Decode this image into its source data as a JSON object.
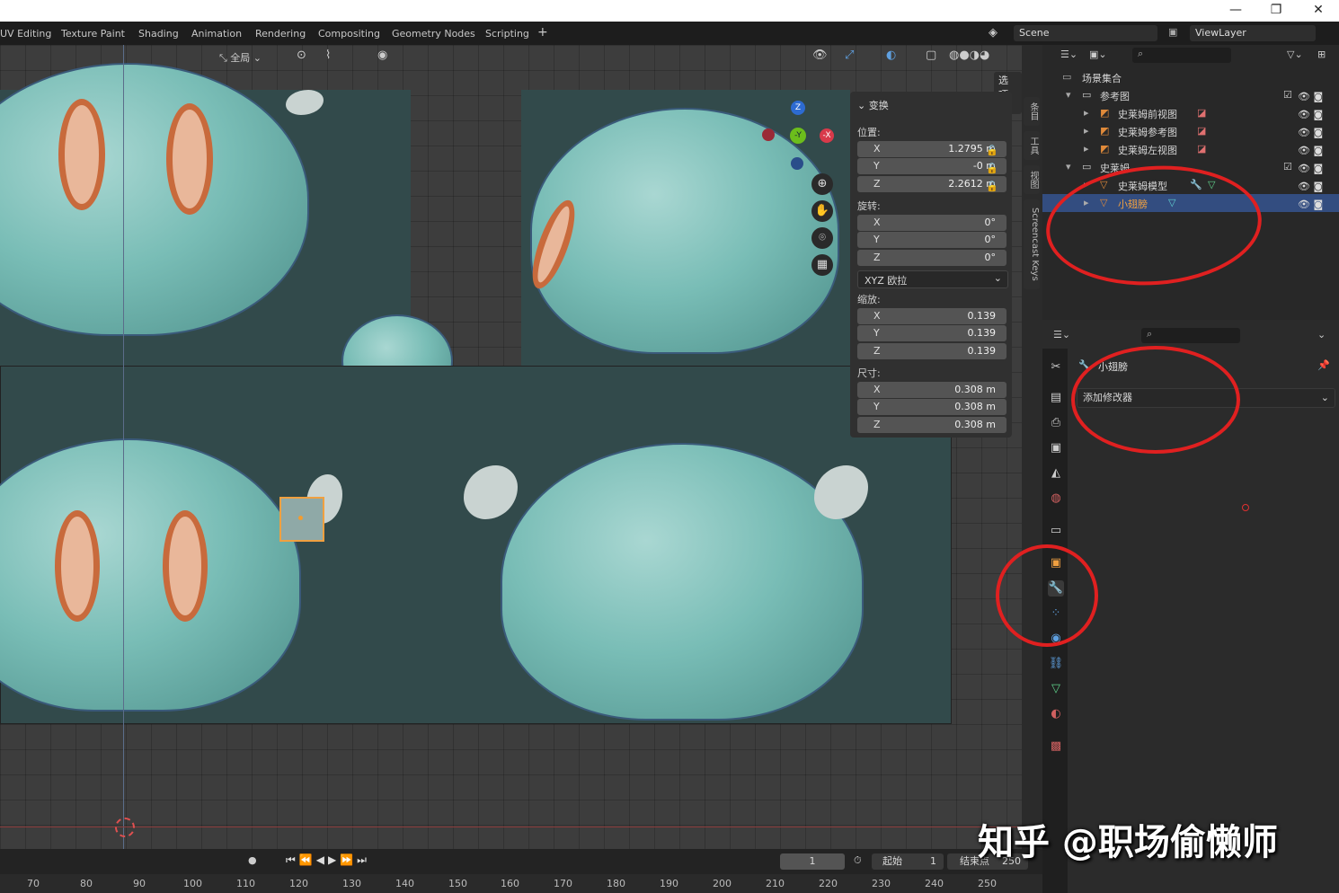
{
  "window": {
    "minimize": "—",
    "maximize": "❐",
    "close": "✕"
  },
  "workspace_tabs": [
    "UV Editing",
    "Texture Paint",
    "Shading",
    "Animation",
    "Rendering",
    "Compositing",
    "Geometry Nodes",
    "Scripting"
  ],
  "add_tab": "+",
  "scene": {
    "name": "Scene",
    "view_layer": "ViewLayer"
  },
  "viewport": {
    "transform_orientation": "全局",
    "options_label": "选项",
    "gizmo": {
      "z": "Z",
      "y": "-Y",
      "x": "-X"
    }
  },
  "npanel": {
    "title": "变换",
    "location_label": "位置:",
    "location": [
      {
        "axis": "X",
        "value": "1.2795 m"
      },
      {
        "axis": "Y",
        "value": "-0 m"
      },
      {
        "axis": "Z",
        "value": "2.2612 m"
      }
    ],
    "rotation_label": "旋转:",
    "rotation": [
      {
        "axis": "X",
        "value": "0°"
      },
      {
        "axis": "Y",
        "value": "0°"
      },
      {
        "axis": "Z",
        "value": "0°"
      }
    ],
    "rotation_mode": "XYZ 欧拉",
    "scale_label": "缩放:",
    "scale": [
      {
        "axis": "X",
        "value": "0.139"
      },
      {
        "axis": "Y",
        "value": "0.139"
      },
      {
        "axis": "Z",
        "value": "0.139"
      }
    ],
    "dimensions_label": "尺寸:",
    "dimensions": [
      {
        "axis": "X",
        "value": "0.308 m"
      },
      {
        "axis": "Y",
        "value": "0.308 m"
      },
      {
        "axis": "Z",
        "value": "0.308 m"
      }
    ]
  },
  "side_tabs": [
    "条目",
    "工具",
    "视图",
    "Screencast Keys"
  ],
  "outliner": {
    "root": "场景集合",
    "items": [
      {
        "label": "参考图",
        "indent": 1,
        "type": "collection"
      },
      {
        "label": "史莱姆前视图",
        "indent": 2,
        "type": "image"
      },
      {
        "label": "史莱姆参考图",
        "indent": 2,
        "type": "image"
      },
      {
        "label": "史莱姆左视图",
        "indent": 2,
        "type": "image"
      },
      {
        "label": "史莱姆",
        "indent": 1,
        "type": "collection"
      },
      {
        "label": "史莱姆模型",
        "indent": 2,
        "type": "mesh"
      },
      {
        "label": "小翅膀",
        "indent": 2,
        "type": "mesh",
        "selected": true
      }
    ]
  },
  "properties": {
    "object_name": "小翅膀",
    "add_modifier": "添加修改器"
  },
  "timeline": {
    "current_frame": "1",
    "start_label": "起始",
    "start": "1",
    "end_label": "结束点",
    "end": "250",
    "ruler": [
      "70",
      "80",
      "90",
      "100",
      "110",
      "120",
      "130",
      "140",
      "150",
      "160",
      "170",
      "180",
      "190",
      "200",
      "210",
      "220",
      "230",
      "240",
      "250"
    ]
  },
  "watermark": "知乎 @职场偷懒师"
}
